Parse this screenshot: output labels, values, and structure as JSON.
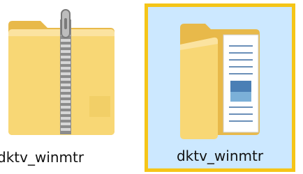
{
  "items": [
    {
      "name": "dktv_winmtr",
      "type": "compressed-folder",
      "icon": "zip-folder-icon",
      "selected": false
    },
    {
      "name": "dktv_winmtr",
      "type": "folder",
      "icon": "folder-with-documents-icon",
      "selected": true
    }
  ],
  "colors": {
    "selection_fill": "#cce8ff",
    "selection_border": "#f5c518",
    "folder_yellow": "#f8d775"
  }
}
